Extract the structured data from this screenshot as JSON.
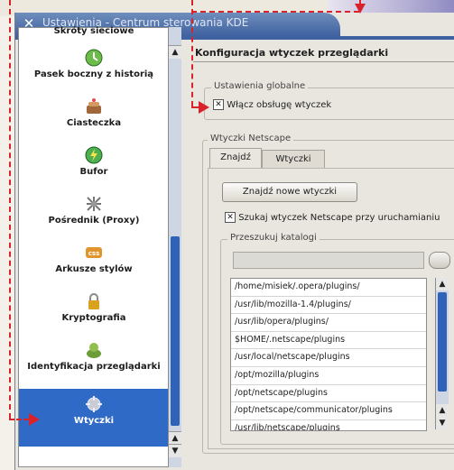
{
  "window": {
    "title": "Ustawienia - Centrum sterowania KDE",
    "close_icon": "close-icon"
  },
  "sidebar": {
    "items": [
      {
        "label": "Skróty sieciowe",
        "icon": "network-shortcuts-icon"
      },
      {
        "label": "Pasek boczny z historią",
        "icon": "history-sidebar-icon"
      },
      {
        "label": "Ciasteczka",
        "icon": "cookie-icon"
      },
      {
        "label": "Bufor",
        "icon": "cache-icon"
      },
      {
        "label": "Pośrednik (Proxy)",
        "icon": "proxy-icon"
      },
      {
        "label": "Arkusze stylów",
        "icon": "css-icon"
      },
      {
        "label": "Kryptografia",
        "icon": "lock-icon"
      },
      {
        "label": "Identyfikacja przeglądarki",
        "icon": "browser-identification-icon"
      },
      {
        "label": "Wtyczki",
        "icon": "plugins-icon",
        "selected": true
      }
    ]
  },
  "main": {
    "title": "Konfiguracja wtyczek przeglądarki",
    "global": {
      "label": "Ustawienia globalne",
      "enable_plugins": {
        "label": "Włącz obsługę wtyczek",
        "checked": true
      }
    },
    "netscape": {
      "label": "Wtyczki Netscape",
      "tabs": [
        {
          "label": "Znajdź",
          "active": true
        },
        {
          "label": "Wtyczki",
          "active": false
        }
      ],
      "find_button": "Znajdź nowe wtyczki",
      "scan_on_startup": {
        "label": "Szukaj wtyczek Netscape przy uruchamianiu",
        "checked": true
      },
      "folders": {
        "label": "Przeszukuj katalogi",
        "path_value": "",
        "paths": [
          "/home/misiek/.opera/plugins/",
          "/usr/lib/mozilla-1.4/plugins/",
          "/usr/lib/opera/plugins/",
          "$HOME/.netscape/plugins",
          "/usr/local/netscape/plugins",
          "/opt/mozilla/plugins",
          "/opt/netscape/plugins",
          "/opt/netscape/communicator/plugins",
          "/usr/lib/netscape/plugins"
        ]
      }
    }
  },
  "colors": {
    "annotation": "#d9232a",
    "selection": "#2f6bc6",
    "titlebar": "#3f62a0"
  }
}
